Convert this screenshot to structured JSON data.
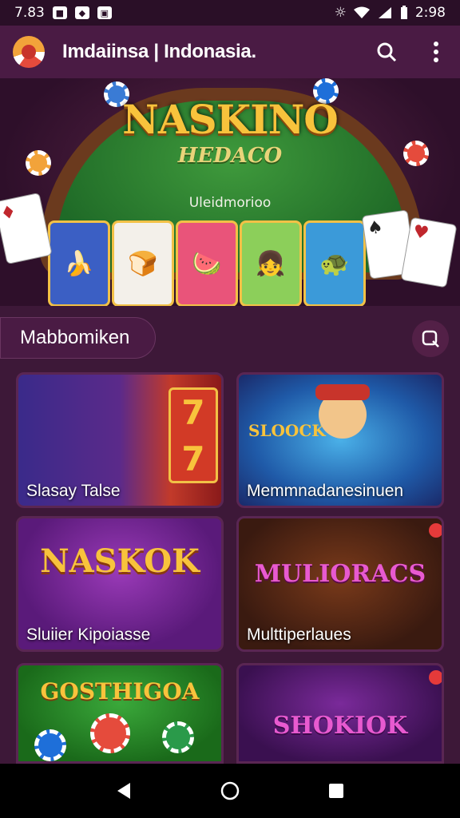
{
  "status_bar": {
    "time_left": "7.83",
    "time_right": "2:98"
  },
  "app_bar": {
    "title": "Imdaiinsa | Indonasia."
  },
  "hero": {
    "title": "NASKINO",
    "subtitle": "HEDACO",
    "caption": "Uleidmorioo"
  },
  "section": {
    "title": "Mabbomiken"
  },
  "tiles": [
    {
      "label": "Slasay Talse",
      "art_text": ""
    },
    {
      "label": "Memmnadanesinuen",
      "art_text": "SLOOCK"
    },
    {
      "label": "Sluiier Kipoiasse",
      "art_text": "NASKOK"
    },
    {
      "label": "Multtiperlaues",
      "art_text": "MULIORACS"
    },
    {
      "label": "",
      "art_text": "GOSTHIGOA"
    },
    {
      "label": "",
      "art_text": "SHOKIOK"
    }
  ],
  "colors": {
    "background": "#3d1838",
    "app_bar": "#4a1b44",
    "accent_gold": "#f8c33c"
  }
}
